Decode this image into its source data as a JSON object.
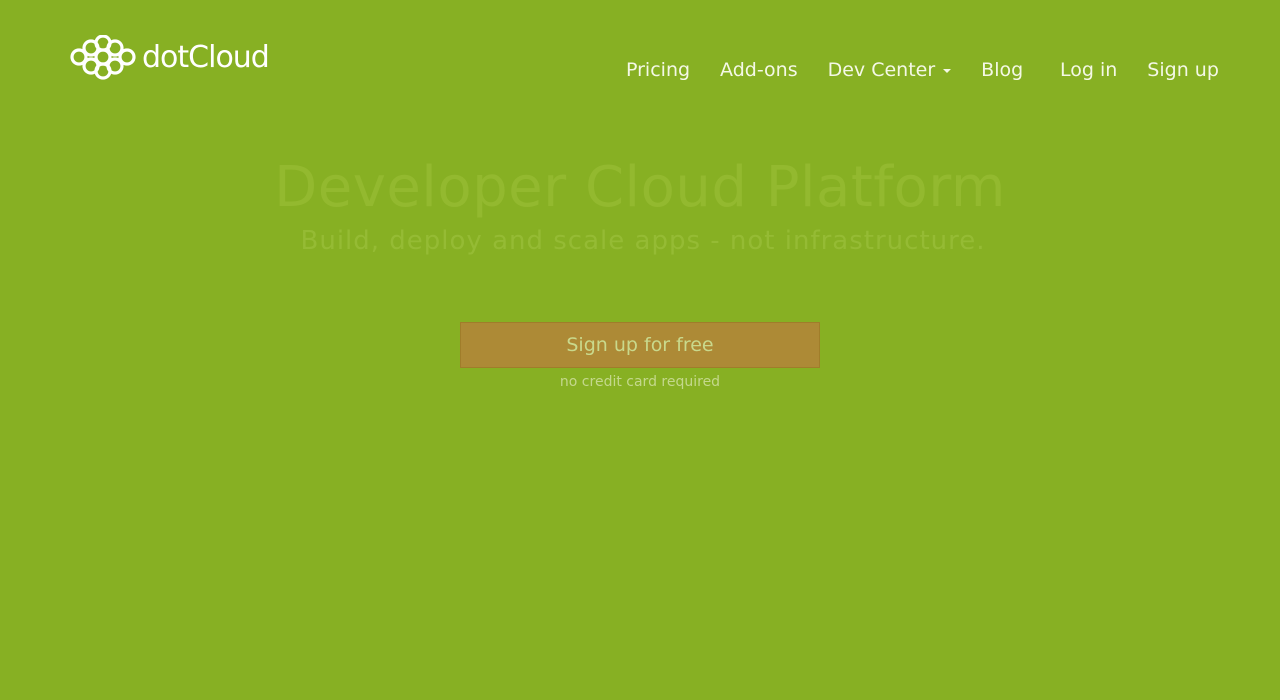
{
  "header": {
    "logo_text": "dotCloud",
    "logo_icon": "cloud-chain-icon",
    "nav": [
      {
        "label": "Pricing"
      },
      {
        "label": "Add-ons"
      },
      {
        "label": "Dev Center",
        "has_dropdown": true
      },
      {
        "label": "Blog"
      }
    ],
    "auth": {
      "login_label": "Log in",
      "signup_label": "Sign up"
    }
  },
  "hero": {
    "title": "Developer Cloud Platform",
    "subtitle": "Build, deploy and scale apps - not infrastructure.",
    "cta_label": "Sign up for free",
    "cta_note": "no credit card required"
  },
  "colors": {
    "background": "#87b023",
    "cta_background": "#ad8a36",
    "nav_text": "#f4f8e6"
  }
}
